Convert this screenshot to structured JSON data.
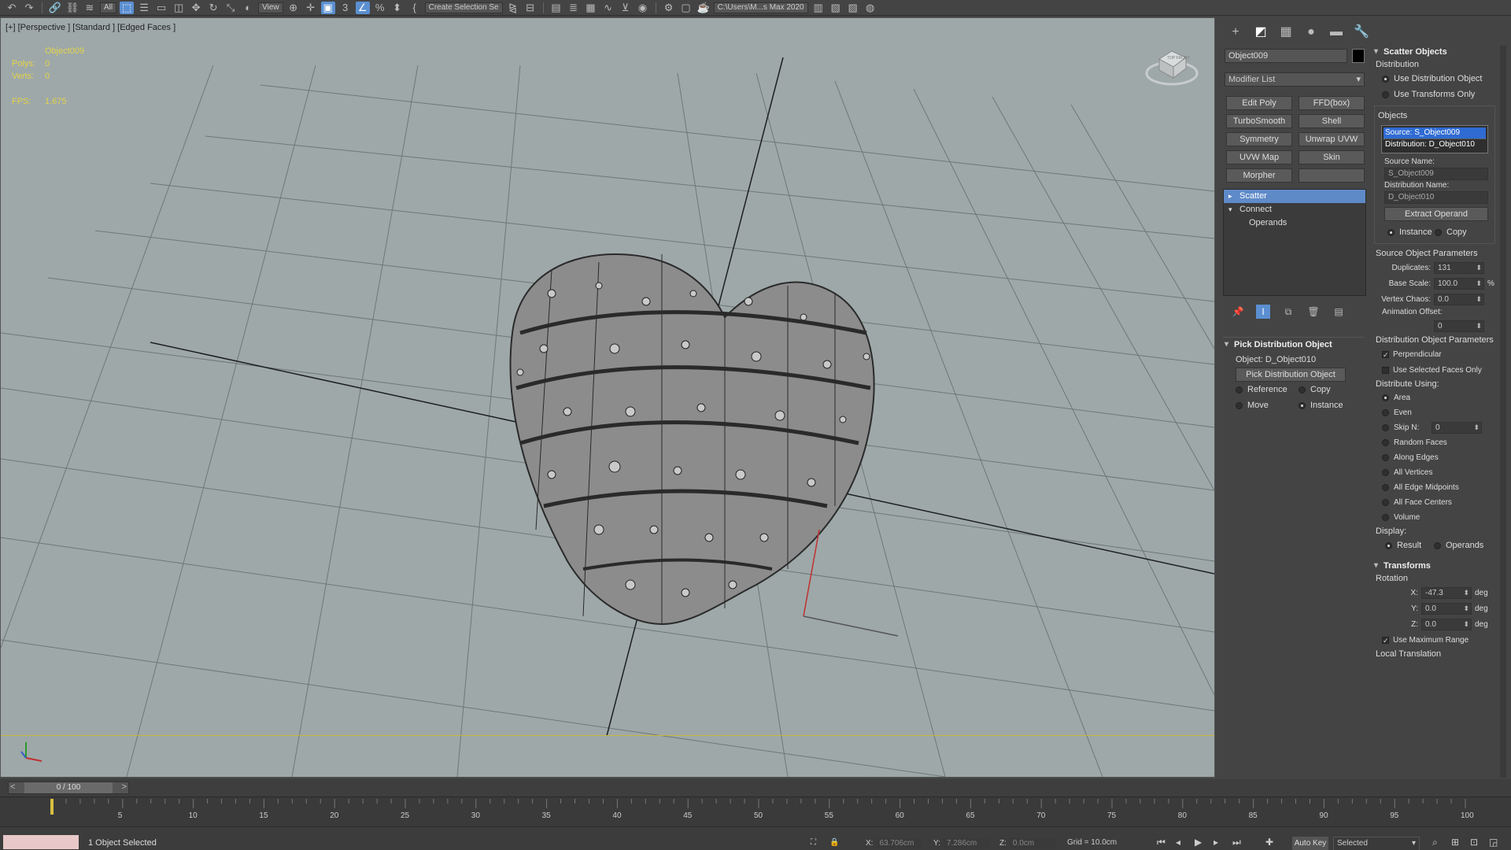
{
  "toolbar": {
    "filter_dropdown": "All",
    "view_dropdown": "View",
    "selection_set": "Create Selection Se",
    "project_path": "C:\\Users\\M...s Max 2020"
  },
  "viewport": {
    "label": "[+] [Perspective ] [Standard ] [Edged Faces ]",
    "object_name": "Object009",
    "polys_label": "Polys:",
    "polys_value": "0",
    "verts_label": "Verts:",
    "verts_value": "0",
    "fps_label": "FPS:",
    "fps_value": "1.675",
    "viewcube_label": "TOP FRONT"
  },
  "command_panel": {
    "object_name": "Object009",
    "modifier_list": "Modifier List",
    "modifier_buttons": [
      "Edit Poly",
      "FFD(box)",
      "TurboSmooth",
      "Shell",
      "Symmetry",
      "Unwrap UVW",
      "UVW Map",
      "Skin",
      "Morpher",
      ""
    ],
    "stack": [
      {
        "label": "Scatter",
        "twist": "▸",
        "selected": true
      },
      {
        "label": "Connect",
        "twist": "▾",
        "selected": false
      },
      {
        "label": "Operands",
        "twist": "",
        "selected": false
      }
    ],
    "pick": {
      "title": "Pick Distribution Object",
      "object_line": "Object: D_Object010",
      "button": "Pick Distribution Object",
      "reference": "Reference",
      "copy": "Copy",
      "move": "Move",
      "instance": "Instance"
    }
  },
  "scatter": {
    "title": "Scatter Objects",
    "distribution_label": "Distribution",
    "use_distribution": "Use Distribution Object",
    "use_transforms": "Use Transforms Only",
    "objects_label": "Objects",
    "source_item": "Source: S_Object009",
    "distribution_item": "Distribution: D_Object010",
    "source_name_label": "Source Name:",
    "source_name": "S_Object009",
    "distribution_name_label": "Distribution Name:",
    "distribution_name": "D_Object010",
    "extract_operand": "Extract Operand",
    "instance": "Instance",
    "copy": "Copy",
    "source_params_label": "Source Object Parameters",
    "duplicates_label": "Duplicates:",
    "duplicates": "131",
    "base_scale_label": "Base Scale:",
    "base_scale": "100.0",
    "base_scale_unit": "%",
    "vertex_chaos_label": "Vertex Chaos:",
    "vertex_chaos": "0.0",
    "anim_offset_label": "Animation Offset:",
    "anim_offset": "0",
    "dist_params_label": "Distribution Object Parameters",
    "perpendicular": "Perpendicular",
    "use_selected_faces": "Use Selected Faces Only",
    "distribute_using": "Distribute Using:",
    "area": "Area",
    "even": "Even",
    "skip_n": "Skip N:",
    "skip_n_value": "0",
    "random_faces": "Random Faces",
    "along_edges": "Along Edges",
    "all_vertices": "All Vertices",
    "all_edge_midpoints": "All Edge Midpoints",
    "all_face_centers": "All Face Centers",
    "volume": "Volume",
    "display_label": "Display:",
    "result": "Result",
    "operands": "Operands",
    "transforms_title": "Transforms",
    "rotation_label": "Rotation",
    "rot_x_label": "X:",
    "rot_x": "-47.3",
    "rot_y_label": "Y:",
    "rot_y": "0.0",
    "rot_z_label": "Z:",
    "rot_z": "0.0",
    "deg": "deg",
    "use_max_range": "Use Maximum Range",
    "local_translation": "Local Translation"
  },
  "timeline": {
    "frame": "0 / 100",
    "ticks": [
      "5",
      "10",
      "15",
      "20",
      "25",
      "30",
      "35",
      "40",
      "45",
      "50",
      "55",
      "60",
      "65",
      "70",
      "75",
      "80",
      "85",
      "90",
      "95",
      "100"
    ]
  },
  "status": {
    "selected": "1 Object Selected",
    "x_label": "X:",
    "x": "63.706cm",
    "y_label": "Y:",
    "y": "7.286cm",
    "z_label": "Z:",
    "z": "0.0cm",
    "grid": "Grid = 10.0cm",
    "auto_key": "Auto Key",
    "selected_set": "Selected"
  }
}
